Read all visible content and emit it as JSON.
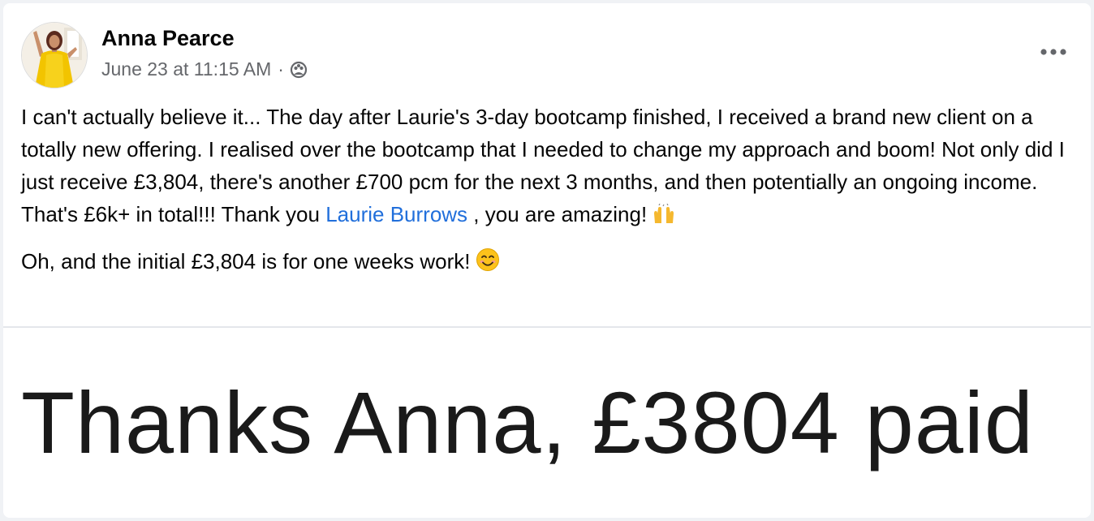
{
  "post": {
    "author": "Anna Pearce",
    "timestamp": "June 23 at 11:15 AM",
    "separator": "·",
    "audience_icon": "friends-icon",
    "more_icon": "more-options-icon"
  },
  "content": {
    "p1_before_mention": "I can't actually believe it... The day after Laurie's 3-day bootcamp finished, I received a brand new client on a totally new offering. I realised over the bootcamp that I needed to change my approach and boom! Not only did I just receive £3,804, there's another £700 pcm for the next 3 months, and then potentially an ongoing income. That's £6k+ in total!!! Thank you ",
    "mention": "Laurie Burrows",
    "p1_after_mention": " , you are amazing!",
    "p1_emoji": "raising-hands-emoji",
    "p2": "Oh, and the initial £3,804 is for one weeks work!",
    "p2_emoji": "smiling-face-emoji"
  },
  "attachment": {
    "text": "Thanks Anna, £3804 paid"
  },
  "colors": {
    "mention": "#216fdb",
    "secondary_text": "#65676b",
    "primary_text": "#050505"
  }
}
